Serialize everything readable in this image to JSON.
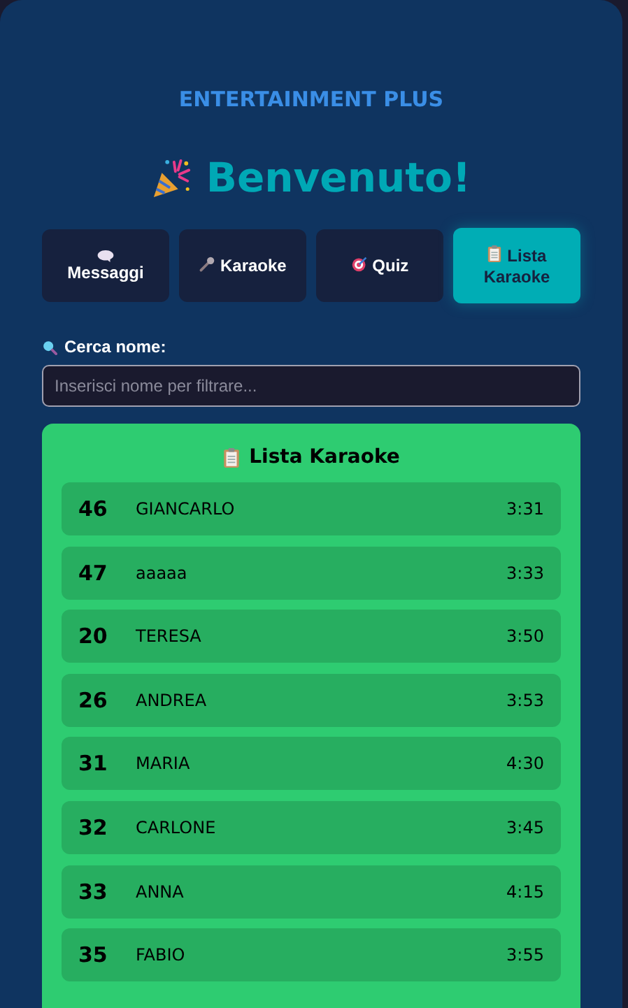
{
  "brand": "ENTERTAINMENT PLUS",
  "greeting": "Benvenuto!",
  "tabs": [
    {
      "label": "Messaggi",
      "kind": "speech",
      "selected": false
    },
    {
      "label": "Karaoke",
      "kind": "mic",
      "selected": false
    },
    {
      "label": "Quiz",
      "kind": "target",
      "selected": false
    },
    {
      "label": "Lista Karaoke",
      "kind": "clipboard",
      "selected": true
    }
  ],
  "search": {
    "label": "Cerca nome:",
    "placeholder": "Inserisci nome per filtrare..."
  },
  "list": {
    "title": "Lista Karaoke",
    "rows": [
      {
        "number": "46",
        "name": "GIANCARLO",
        "time": "3:31"
      },
      {
        "number": "47",
        "name": "aaaaa",
        "time": "3:33"
      },
      {
        "number": "20",
        "name": "TERESA",
        "time": "3:50"
      },
      {
        "number": "26",
        "name": "ANDREA",
        "time": "3:53"
      },
      {
        "number": "31",
        "name": "MARIA",
        "time": "4:30"
      },
      {
        "number": "32",
        "name": "CARLONE",
        "time": "3:45"
      },
      {
        "number": "33",
        "name": "ANNA",
        "time": "4:15"
      },
      {
        "number": "35",
        "name": "FABIO",
        "time": "3:55"
      }
    ]
  }
}
